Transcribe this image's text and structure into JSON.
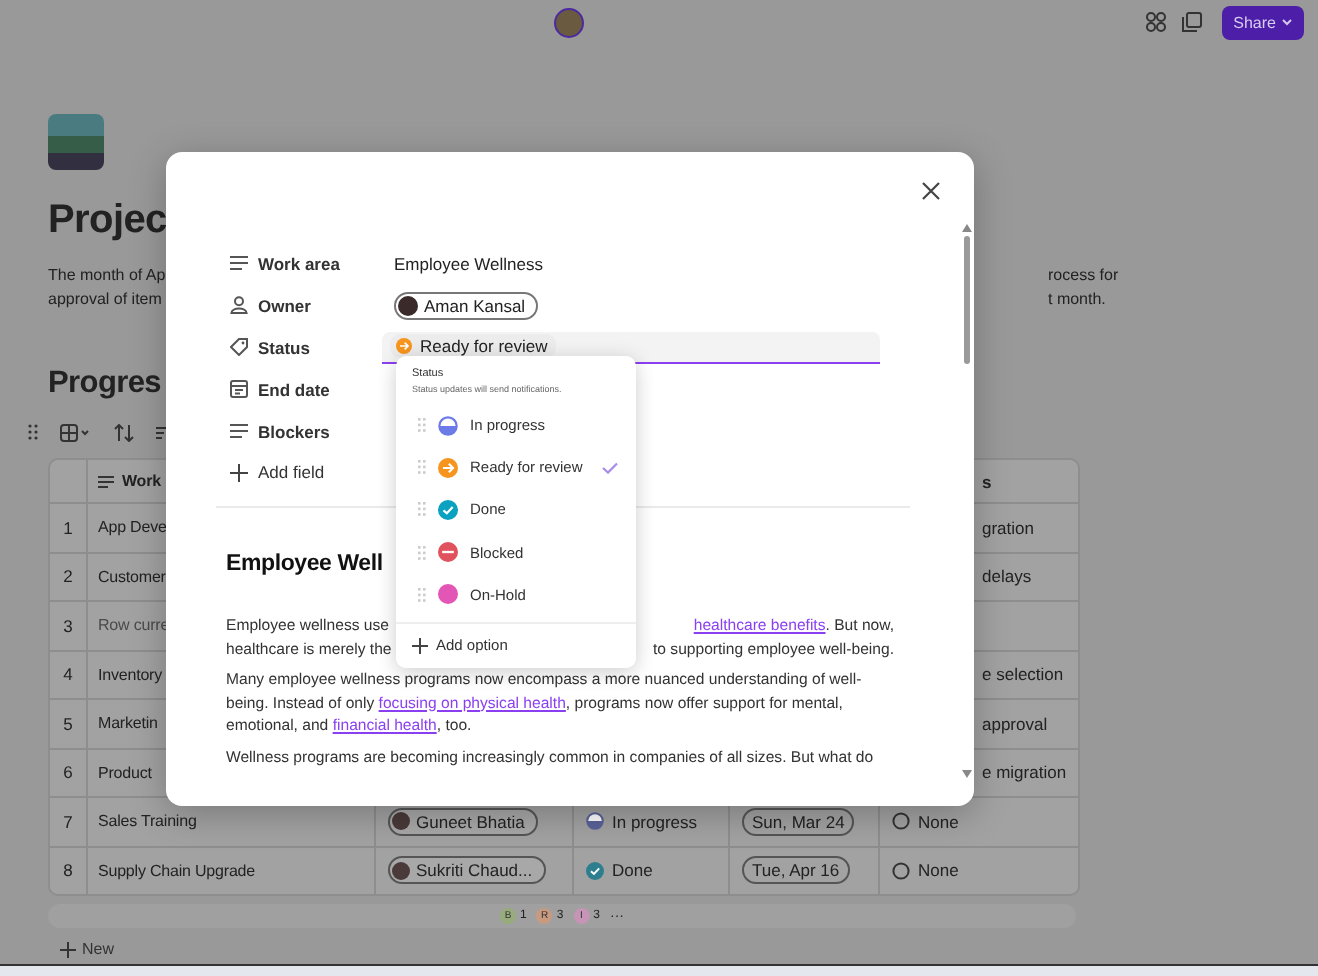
{
  "topbar": {
    "share": "Share"
  },
  "page": {
    "title": "Projec",
    "description_left": [
      "The month of Ap",
      "approval of item"
    ],
    "description_right": [
      "rocess for",
      "t month."
    ],
    "section": "Progres"
  },
  "table": {
    "header": {
      "work": "Work",
      "column_6": "s"
    },
    "rows": [
      {
        "kind": "partial",
        "number": "1",
        "work": "App Deve",
        "column_6": "gration"
      },
      {
        "kind": "partial",
        "number": "2",
        "work": "Customer",
        "column_6": "delays"
      },
      {
        "kind": "partial",
        "number": "3",
        "work": "Row curre",
        "muted": true
      },
      {
        "kind": "partial",
        "number": "4",
        "work": "Inventory",
        "column_6": "e selection"
      },
      {
        "kind": "partial",
        "number": "5",
        "work": "Marketin",
        "column_6": "approval"
      },
      {
        "kind": "partial",
        "number": "6",
        "work": "Product",
        "column_6": "e migration"
      },
      {
        "kind": "full",
        "number": "7",
        "work": "Sales Training",
        "owner": "Guneet Bhatia",
        "status": {
          "label": "In progress",
          "kind": "in_progress",
          "color": "#5a629a"
        },
        "end_date": "Sun, Mar 24",
        "blockers": "None"
      },
      {
        "kind": "full",
        "number": "8",
        "work": "Supply Chain Upgrade",
        "owner": "Sukriti Chaud...",
        "status": {
          "label": "Done",
          "kind": "done",
          "color": "#2d7f8f"
        },
        "end_date": "Tue, Apr 16",
        "blockers": "None"
      }
    ],
    "footer": [
      {
        "letter": "B",
        "count": "1",
        "color": "#97ab7c"
      },
      {
        "letter": "R",
        "count": "3",
        "color": "#c89a80"
      },
      {
        "letter": "I",
        "count": "3",
        "color": "#c594b6"
      }
    ],
    "more": "···"
  },
  "new_button": "New",
  "modal": {
    "fields": [
      {
        "kind": "text",
        "label": "Work area",
        "value": "Employee Wellness"
      },
      {
        "kind": "person",
        "label": "Owner",
        "value": "Aman Kansal"
      },
      {
        "kind": "status",
        "label": "Status",
        "value": "Ready for review"
      },
      {
        "kind": "date",
        "label": "End date"
      },
      {
        "kind": "text",
        "label": "Blockers"
      }
    ],
    "add_field": "Add field",
    "heading": "Employee Well",
    "paragraph_1": [
      {
        "left": "Employee wellness use",
        "right": [
          {
            "text": "healthcare benefits",
            "link": true
          },
          {
            "text": ". But now,"
          }
        ]
      },
      {
        "left": "healthcare is merely the",
        "right": [
          {
            "text": "to supporting employee well-being."
          }
        ]
      }
    ],
    "paragraph_2": [
      {
        "text": "Many employee wellness programs now encompass a more nuanced understanding of well-being. Instead of only "
      },
      {
        "text": "focusing on physical health",
        "link": true
      },
      {
        "text": ", programs now offer support for mental, emotional, and "
      },
      {
        "text": "financial health",
        "link": true
      },
      {
        "text": ", too."
      }
    ],
    "paragraph_3": "Wellness programs are becoming increasingly common in companies of all sizes. But what do"
  },
  "dropdown": {
    "title": "Status",
    "hint": "Status updates will send notifications.",
    "options": [
      {
        "label": "In progress",
        "kind": "in_progress",
        "color": "#6b7be8",
        "selected": false
      },
      {
        "label": "Ready for review",
        "kind": "ready",
        "color": "#f7941d",
        "selected": true
      },
      {
        "label": "Done",
        "kind": "done",
        "color": "#0aa2c0",
        "selected": false
      },
      {
        "label": "Blocked",
        "kind": "blocked",
        "color": "#e0525c",
        "selected": false
      },
      {
        "label": "On-Hold",
        "kind": "on_hold",
        "color": "#e356b5",
        "selected": false
      }
    ],
    "add_option": "Add option"
  }
}
